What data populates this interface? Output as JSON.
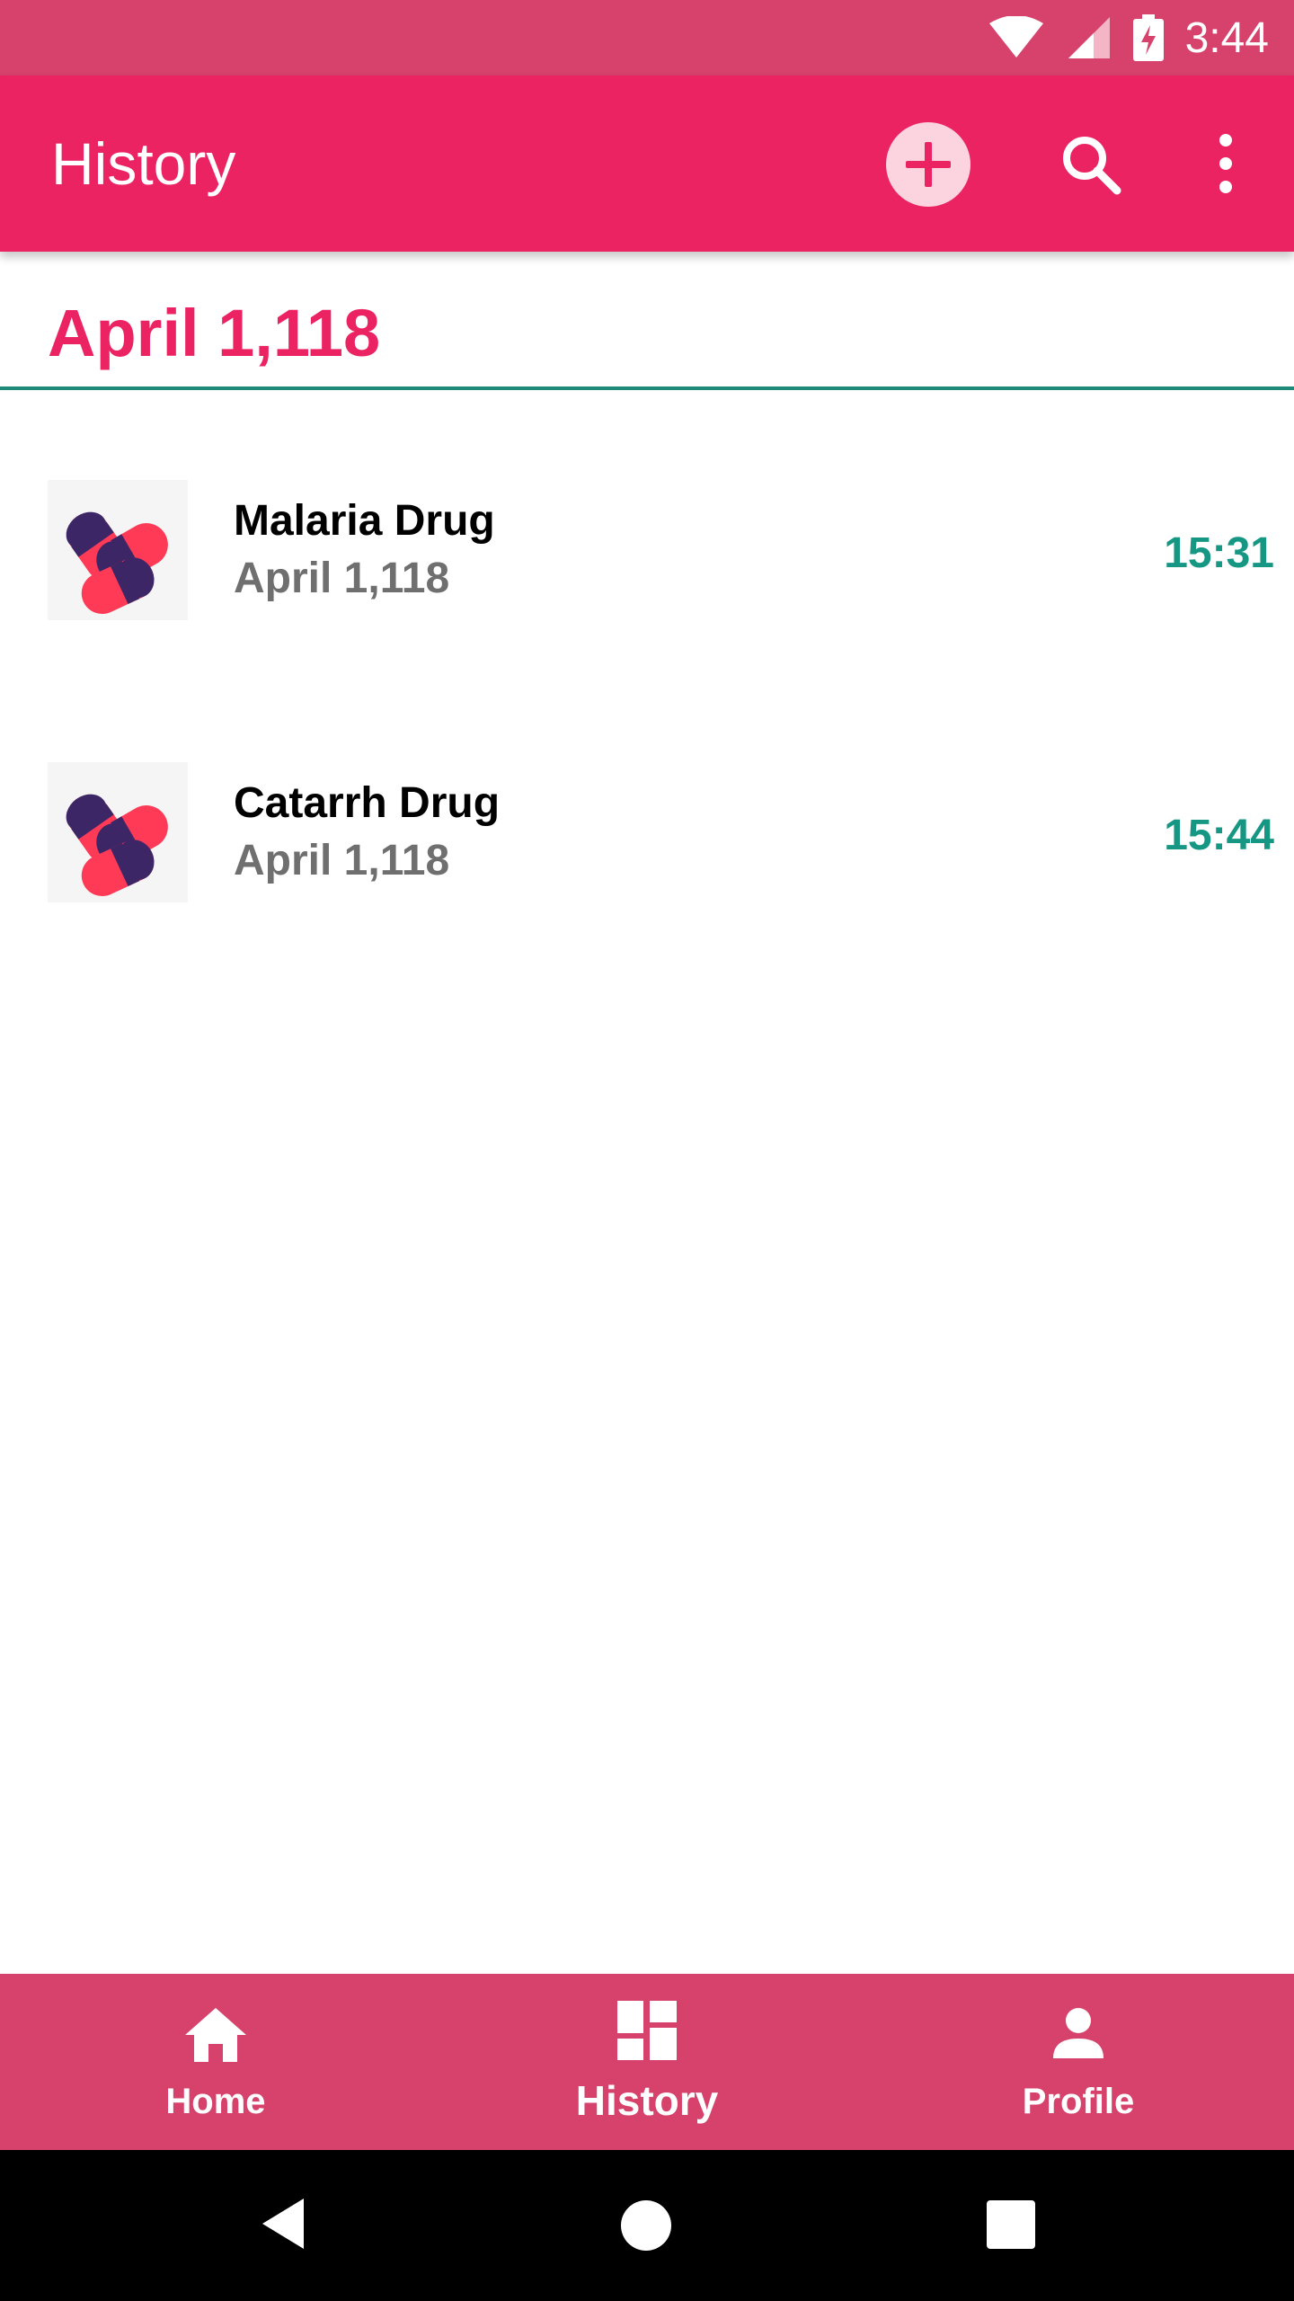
{
  "status_bar": {
    "time": "3:44",
    "icons": [
      "wifi-icon",
      "signal-icon",
      "battery-charging-icon"
    ]
  },
  "app_bar": {
    "title": "History",
    "actions": [
      "add-circle-icon",
      "search-icon",
      "more-vert-icon"
    ],
    "color": "#ec2363"
  },
  "section": {
    "title": "April 1,118",
    "color": "#ec2363"
  },
  "entries": [
    {
      "name": "Malaria Drug",
      "date": "April 1,118",
      "time": "15:31"
    },
    {
      "name": "Catarrh Drug",
      "date": "April 1,118",
      "time": "15:44"
    }
  ],
  "bottom_nav": {
    "items": [
      {
        "label": "Home",
        "icon": "home-icon"
      },
      {
        "label": "History",
        "icon": "dashboard-icon",
        "active": true
      },
      {
        "label": "Profile",
        "icon": "person-icon"
      }
    ],
    "color": "#d6426b"
  },
  "system_nav": {
    "icons": [
      "back-icon",
      "home-circle-icon",
      "recents-icon"
    ]
  },
  "colors": {
    "accent": "#ec2363",
    "time_teal": "#169784",
    "divider": "#1f8a7a"
  }
}
